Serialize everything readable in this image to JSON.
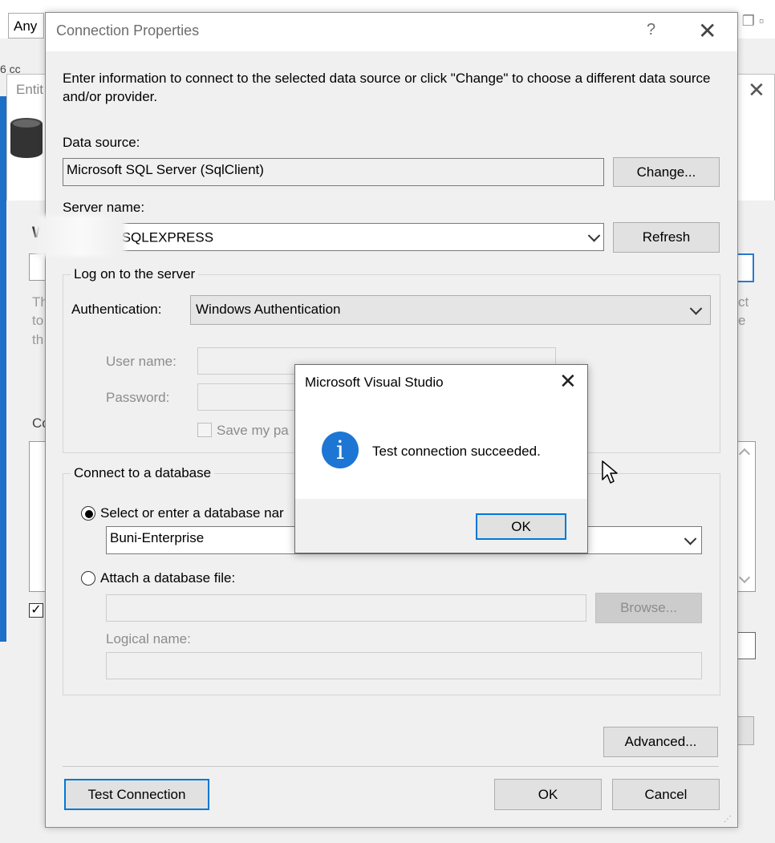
{
  "background": {
    "toolbar_combo": "Any",
    "wizard_title": "Entit",
    "wizard_heading_fragment": "W",
    "fragments": [
      "Th",
      "to",
      "th",
      "Co",
      "ct",
      "e",
      "6 cc"
    ],
    "close_glyph": "✕"
  },
  "dialog": {
    "title": "Connection Properties",
    "help_glyph": "?",
    "close_glyph": "✕",
    "intro": "Enter information to connect to the selected data source or click \"Change\" to choose a different data source and/or provider.",
    "data_source_label": "Data source:",
    "data_source_value": "Microsoft SQL Server (SqlClient)",
    "change_button": "Change...",
    "server_name_label": "Server name:",
    "server_name_value": "\\SQLEXPRESS",
    "refresh_button": "Refresh",
    "logon_group": "Log on to the server",
    "authentication_label": "Authentication:",
    "authentication_value": "Windows Authentication",
    "user_name_label": "User name:",
    "password_label": "Password:",
    "save_password_label": "Save my pa",
    "database_group": "Connect to a database",
    "select_db_radio_label": "Select or enter a database nar",
    "database_value": "Buni-Enterprise",
    "attach_db_radio_label": "Attach a database file:",
    "browse_button": "Browse...",
    "logical_name_label": "Logical name:",
    "advanced_button": "Advanced...",
    "test_connection_button": "Test Connection",
    "ok_button": "OK",
    "cancel_button": "Cancel"
  },
  "message_box": {
    "title": "Microsoft Visual Studio",
    "close_glyph": "✕",
    "icon_glyph": "i",
    "text": "Test connection succeeded.",
    "ok_button": "OK"
  },
  "colors": {
    "accent": "#0078d7",
    "info_icon": "#1e76d4",
    "dialog_bg": "#f0f0f0"
  }
}
